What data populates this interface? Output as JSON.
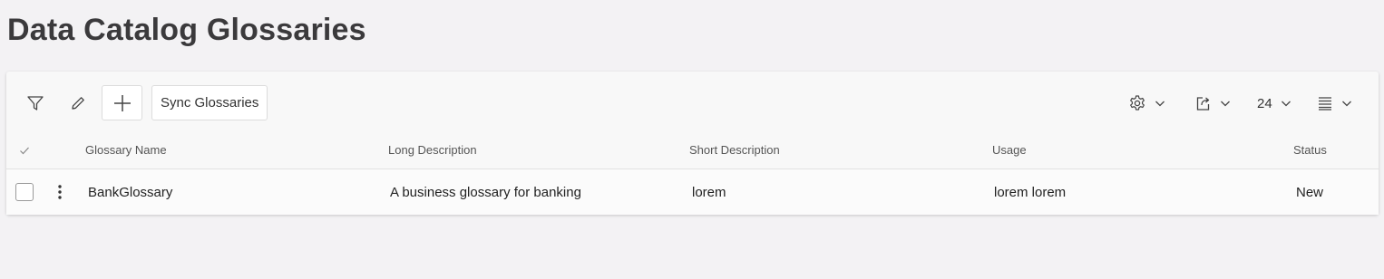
{
  "page": {
    "title": "Data Catalog Glossaries"
  },
  "toolbar": {
    "filter_icon": "filter-icon",
    "edit_icon": "pencil-icon",
    "add_icon": "plus-icon",
    "sync_label": "Sync Glossaries",
    "settings_icon": "gear-icon",
    "export_icon": "export-icon",
    "page_size": "24",
    "layout_icon": "list-layout-icon"
  },
  "table": {
    "columns": [
      "Glossary Name",
      "Long Description",
      "Short Description",
      "Usage",
      "Status"
    ],
    "rows": [
      {
        "glossary_name": "BankGlossary",
        "long_description": "A business glossary for banking",
        "short_description": "lorem",
        "usage": "lorem lorem",
        "status": "New"
      }
    ]
  }
}
